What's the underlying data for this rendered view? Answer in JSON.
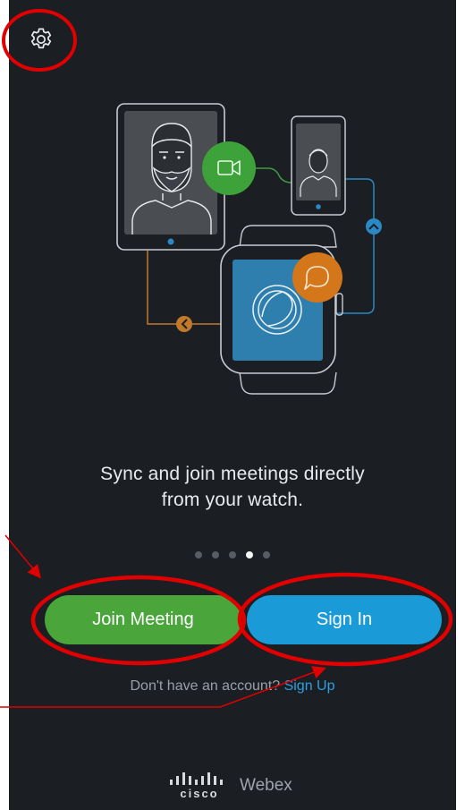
{
  "onboarding": {
    "tagline_line1": "Sync and join meetings directly",
    "tagline_line2": "from your watch.",
    "page_count": 5,
    "active_page": 4
  },
  "actions": {
    "join_label": "Join Meeting",
    "signin_label": "Sign In"
  },
  "signup": {
    "prompt": "Don't have an account?",
    "link_label": "Sign Up"
  },
  "brand": {
    "company": "cisco",
    "product": "Webex"
  },
  "icons": {
    "settings": "gear-icon",
    "video": "video-camera-icon",
    "chat": "chat-bubble-icon",
    "app_logo": "webex-logo-icon",
    "arrow_up": "chevron-up-icon",
    "arrow_left": "chevron-left-icon"
  },
  "colors": {
    "background": "#1b1e23",
    "join": "#4aa63b",
    "signin": "#1a9ad6",
    "link": "#2e9fe0",
    "annotation": "#e00000"
  }
}
